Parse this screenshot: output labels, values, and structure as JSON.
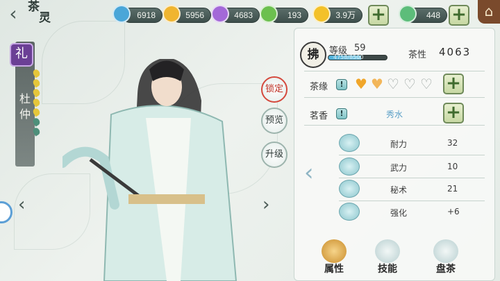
{
  "header": {
    "back_icon": "chevron-left-icon",
    "logo_text_top": "茶",
    "logo_text_bottom": "灵",
    "home_icon": "house-icon"
  },
  "currencies": [
    {
      "name": "blue-gem",
      "value": "6918",
      "color": "#4aa6d8"
    },
    {
      "name": "gold-leaf",
      "value": "5956",
      "color": "#f0b530"
    },
    {
      "name": "purple-gem",
      "value": "4683",
      "color": "#a369d8"
    },
    {
      "name": "green-gem",
      "value": "193",
      "color": "#6cc04f"
    },
    {
      "name": "gold-coin",
      "value": "3.9万",
      "color": "#f3c129"
    },
    {
      "name": "green-crystal",
      "value": "448",
      "color": "#5dbd7a"
    }
  ],
  "character": {
    "element_glyph": "礼",
    "name": "杜仲",
    "element_color": "#6b3f95",
    "star_colors": [
      "#e5c63a",
      "#e5c63a",
      "#e5c63a",
      "#e5c63a",
      "#e5c63a",
      "#4d8f7a",
      "#4d8f7a"
    ]
  },
  "side_buttons": [
    {
      "label": "锁定",
      "active": true
    },
    {
      "label": "预览",
      "active": false
    },
    {
      "label": "升级",
      "active": false
    }
  ],
  "panel": {
    "rank_glyph": "拂",
    "level_label": "等级",
    "level": "59",
    "xp_text": "4758/8500",
    "xp_fraction": 0.56,
    "tea_label": "茶性",
    "tea_value": "4063",
    "affinity_label": "茶缘",
    "hearts": [
      "filled",
      "half",
      "empty",
      "empty",
      "empty"
    ],
    "fragrance_label": "茗香",
    "fragrance_value": "秀水",
    "stats": [
      {
        "name": "耐力",
        "value": "32",
        "icon": "stamina-icon"
      },
      {
        "name": "武力",
        "value": "10",
        "icon": "force-icon"
      },
      {
        "name": "秘术",
        "value": "21",
        "icon": "arcane-icon"
      },
      {
        "name": "强化",
        "value": "+6",
        "icon": "enhance-icon"
      }
    ]
  },
  "tabs": [
    {
      "label": "属性",
      "icon": "teapot-icon"
    },
    {
      "label": "技能",
      "icon": "skill-icon"
    },
    {
      "label": "盘茶",
      "icon": "tea-tray-icon"
    }
  ]
}
